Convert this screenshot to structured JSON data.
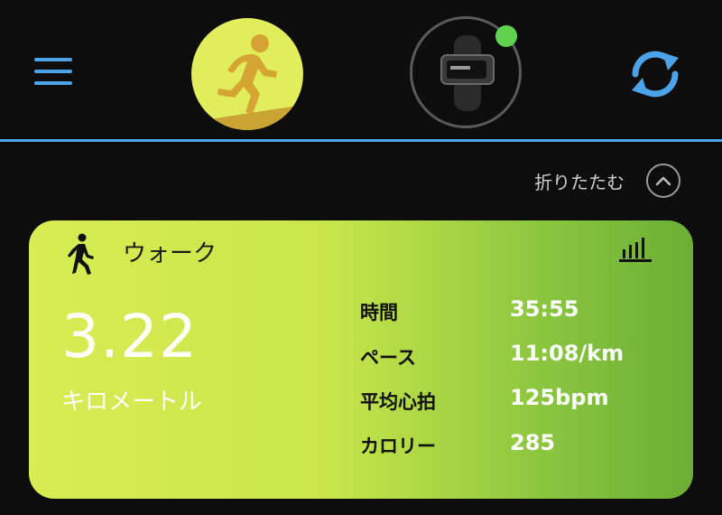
{
  "header": {
    "menu_icon": "hamburger-menu-icon",
    "activity_icon": "running-person-icon",
    "device_icon": "fitness-band-icon",
    "device_status_color": "#5fd34f",
    "sync_icon": "sync-icon",
    "accent_color": "#4da3e8"
  },
  "collapse": {
    "label": "折りたたむ",
    "icon": "chevron-up-icon"
  },
  "card": {
    "activity_icon": "walking-person-icon",
    "title": "ウォーク",
    "chart_icon": "bar-chart-icon",
    "distance": "3.22",
    "distance_unit": "キロメートル",
    "stats": [
      {
        "label": "時間",
        "value": "35:55"
      },
      {
        "label": "ペース",
        "value": "11:08/km"
      },
      {
        "label": "平均心拍",
        "value": "125bpm"
      },
      {
        "label": "カロリー",
        "value": "285"
      }
    ]
  }
}
